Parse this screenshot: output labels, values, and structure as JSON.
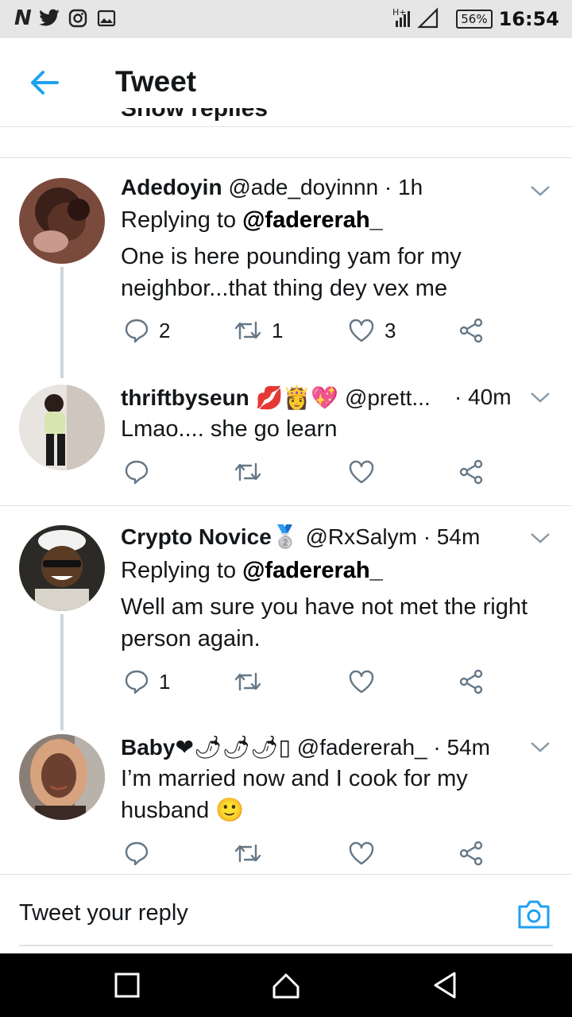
{
  "status_bar": {
    "left_icons": [
      "n-icon",
      "twitter-bird-icon",
      "instagram-icon",
      "gallery-icon"
    ],
    "network": "H+",
    "battery": "56%",
    "time": "16:54"
  },
  "header": {
    "title": "Tweet"
  },
  "cut_text": "Show replies",
  "tweets": [
    {
      "name": "Adedoyin",
      "meta": "@ade_doyinnn · 1h",
      "replying_label": "Replying to",
      "mention": "@fadererah_",
      "body_line1": "One is here pounding yam for my",
      "body_line2": "neighbor...that thing dey vex me",
      "replies": "2",
      "retweets": "1",
      "likes": "3"
    },
    {
      "name": "thriftbyseun",
      "name_emoji": "💋👸💖",
      "meta": "@prett...",
      "time": "· 40m",
      "body_line1": "Lmao.... she go learn",
      "replies": "",
      "retweets": "",
      "likes": ""
    },
    {
      "name": "Crypto Novice",
      "name_emoji": "🥈",
      "meta": "@RxSalym · 54m",
      "replying_label": "Replying to",
      "mention": "@fadererah_",
      "body_line1": "Well am sure you have not met the right",
      "body_line2": "person again.",
      "replies": "1",
      "retweets": "",
      "likes": ""
    },
    {
      "name": "Baby",
      "name_emoji": "❤🌶🌶🌶▯",
      "meta": "@fadererah_ · 54m",
      "body_line1": "I’m married now and I cook for my",
      "body_line2": "husband",
      "body_emoji": "🙂",
      "replies": "",
      "retweets": "",
      "likes": ""
    }
  ],
  "reply_bar": {
    "placeholder": "Tweet your reply"
  },
  "colors": {
    "accent": "#1da1f2",
    "text": "#14171a",
    "icon_gray": "#657786",
    "divider": "#dde3e7",
    "thread": "#ccd6dd"
  }
}
